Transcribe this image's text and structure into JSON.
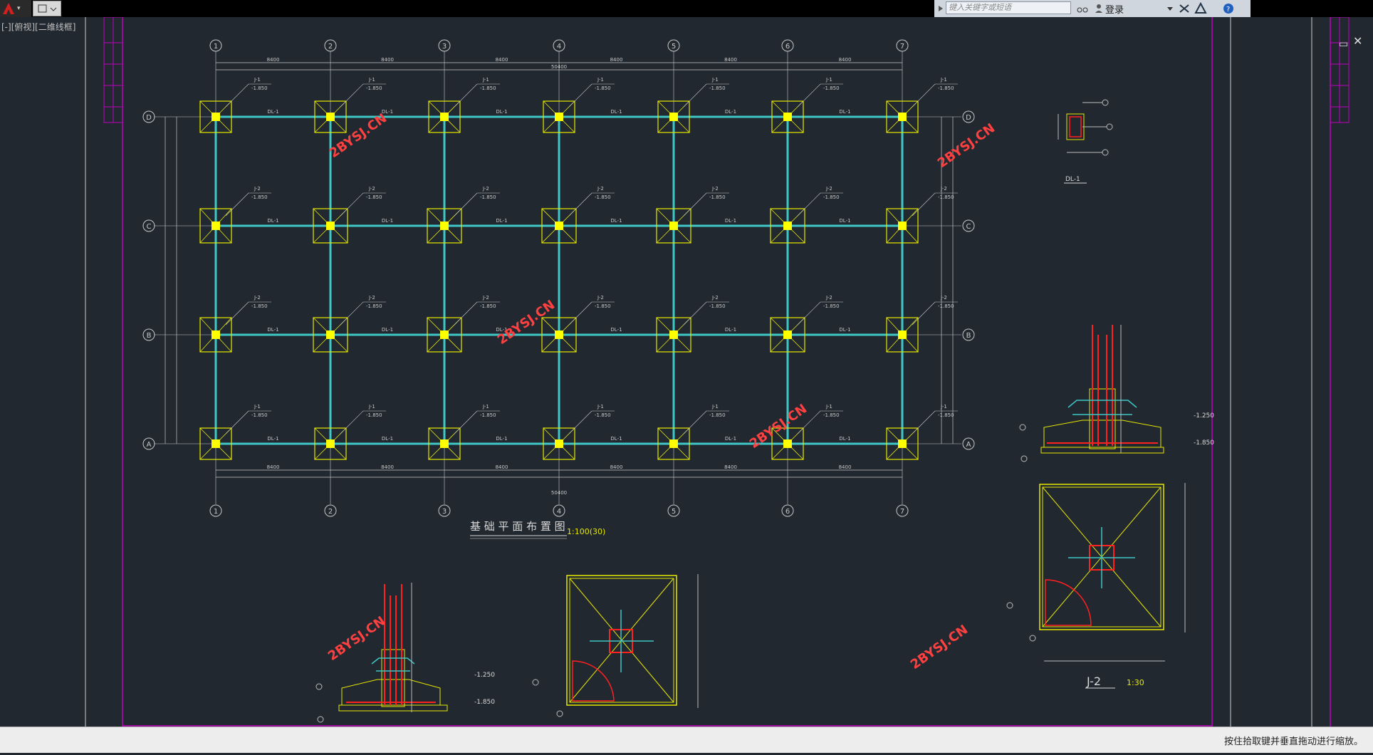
{
  "toolbar": {
    "search_placeholder": "键入关键字或短语",
    "login_label": "登录"
  },
  "viewport": {
    "label": "[-][俯视][二维线框]"
  },
  "status": {
    "hint": "按住拾取键并垂直拖动进行缩放。"
  },
  "drawing": {
    "grid_numbers": [
      "1",
      "2",
      "3",
      "4",
      "5",
      "6",
      "7"
    ],
    "grid_letters": [
      "D",
      "C",
      "B",
      "A"
    ],
    "span_dims": [
      "8400",
      "8400",
      "8400",
      "8400",
      "8400",
      "8400"
    ],
    "total_dim": "50400",
    "beam_label": "DL-1",
    "footing_j1": "J-1",
    "footing_j2": "J-2",
    "elev": "-1.850",
    "plan_title": "基 础 平 面 布 置 图",
    "plan_scale": "1:100(30)",
    "detail_j2_title": "J-2",
    "detail_j2_scale": "1:30",
    "section_label": "DL-1",
    "watermark": "2BYSJ.CN",
    "elev_1250": "-1.250",
    "elev_1850": "-1.850"
  },
  "colors": {
    "canvas": "#212830",
    "yellow": "#e8e800",
    "cyan": "#3fc6c6",
    "red": "#ff2020",
    "magenta": "#c000c0"
  }
}
